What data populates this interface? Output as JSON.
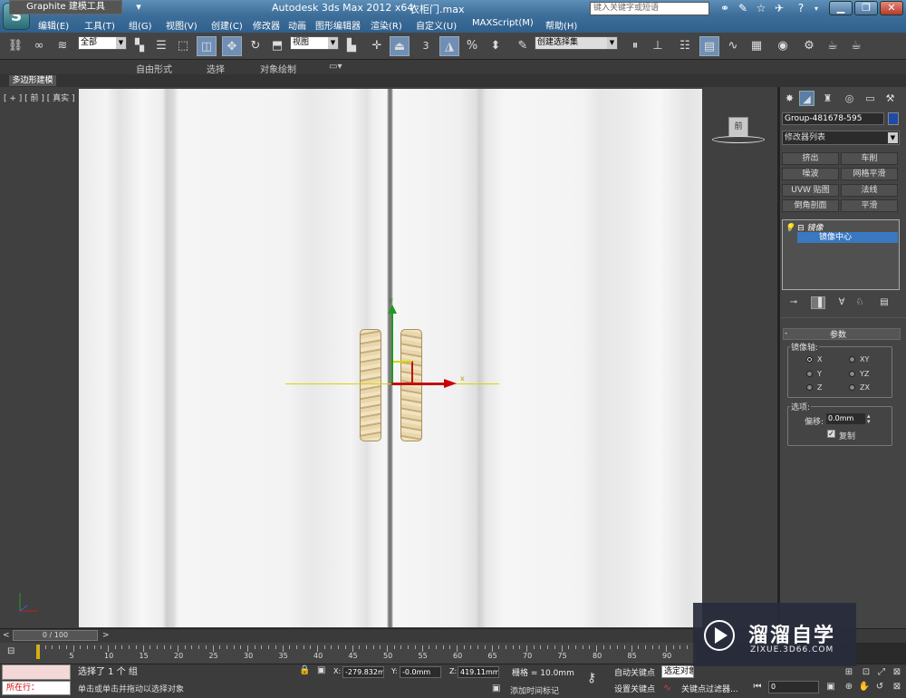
{
  "title_bar": {
    "logo": "3ds-max-logo",
    "app_title": "Autodesk 3ds Max  2012 x64",
    "file_name": "衣柜门.max",
    "search_placeholder": "键入关键字或短语",
    "window_minimize": "▁",
    "window_maximize": "❐",
    "window_close": "✕"
  },
  "menu": {
    "items": [
      "编辑(E)",
      "工具(T)",
      "组(G)",
      "视图(V)",
      "创建(C)",
      "修改器",
      "动画",
      "图形编辑器",
      "渲染(R)",
      "自定义(U)",
      "MAXScript(M)",
      "帮助(H)"
    ]
  },
  "toolbar": {
    "selection_filter": "全部",
    "reference_coord": "视图",
    "named_selection": "创建选择集",
    "snap_label": "3",
    "percent_label": "%"
  },
  "ribbon": {
    "tabs": [
      "Graphite 建模工具",
      "自由形式",
      "选择",
      "对象绘制"
    ],
    "active_sub": "多边形建模"
  },
  "viewport": {
    "label": "[ + ] [ 前 ] [ 真实 ]",
    "viewcube_face": "前",
    "gizmo_y": "y",
    "gizmo_x": "x"
  },
  "command_panel": {
    "object_name": "Group-481678-595",
    "object_color": "#1f4aa8",
    "modifier_list": "修改器列表",
    "modifier_buttons": [
      "挤出",
      "车削",
      "噪波",
      "网格平滑",
      "UVW 贴图",
      "法线",
      "倒角剖面",
      "平滑"
    ],
    "stack_root": "镜像",
    "stack_sub": "镜像中心",
    "rollout_title": "参数",
    "mirror_axis_label": "镜像轴:",
    "axes": [
      "X",
      "XY",
      "Y",
      "YZ",
      "Z",
      "ZX"
    ],
    "selected_axis": "X",
    "options_label": "选项:",
    "offset_label": "偏移:",
    "offset_value": "0.0mm",
    "copy_label": "复制",
    "copy_checked": true
  },
  "timeline": {
    "frame_slider": "0 / 100",
    "tick_labels": [
      "0",
      "5",
      "10",
      "15",
      "20",
      "25",
      "30",
      "35",
      "40",
      "45",
      "50",
      "55",
      "60",
      "65",
      "70",
      "75",
      "80",
      "85",
      "90"
    ]
  },
  "status_bar": {
    "running_label": "所在行：",
    "selection_status": "选择了 1 个 组",
    "prompt": "单击或单击并拖动以选择对象",
    "x_label": "X:",
    "x_value": "-279.832m",
    "y_label": "Y:",
    "y_value": "-0.0mm",
    "z_label": "Z:",
    "z_value": "419.11mm",
    "grid": "栅格 = 10.0mm",
    "add_time_tag": "添加时间标记",
    "auto_key": "自动关键点",
    "selected_object": "选定对象",
    "set_key": "设置关键点",
    "key_filter": "关键点过滤器...",
    "current_frame": "0"
  },
  "watermark": {
    "name": "溜溜自学",
    "url": "ZIXUE.3D66.COM"
  }
}
